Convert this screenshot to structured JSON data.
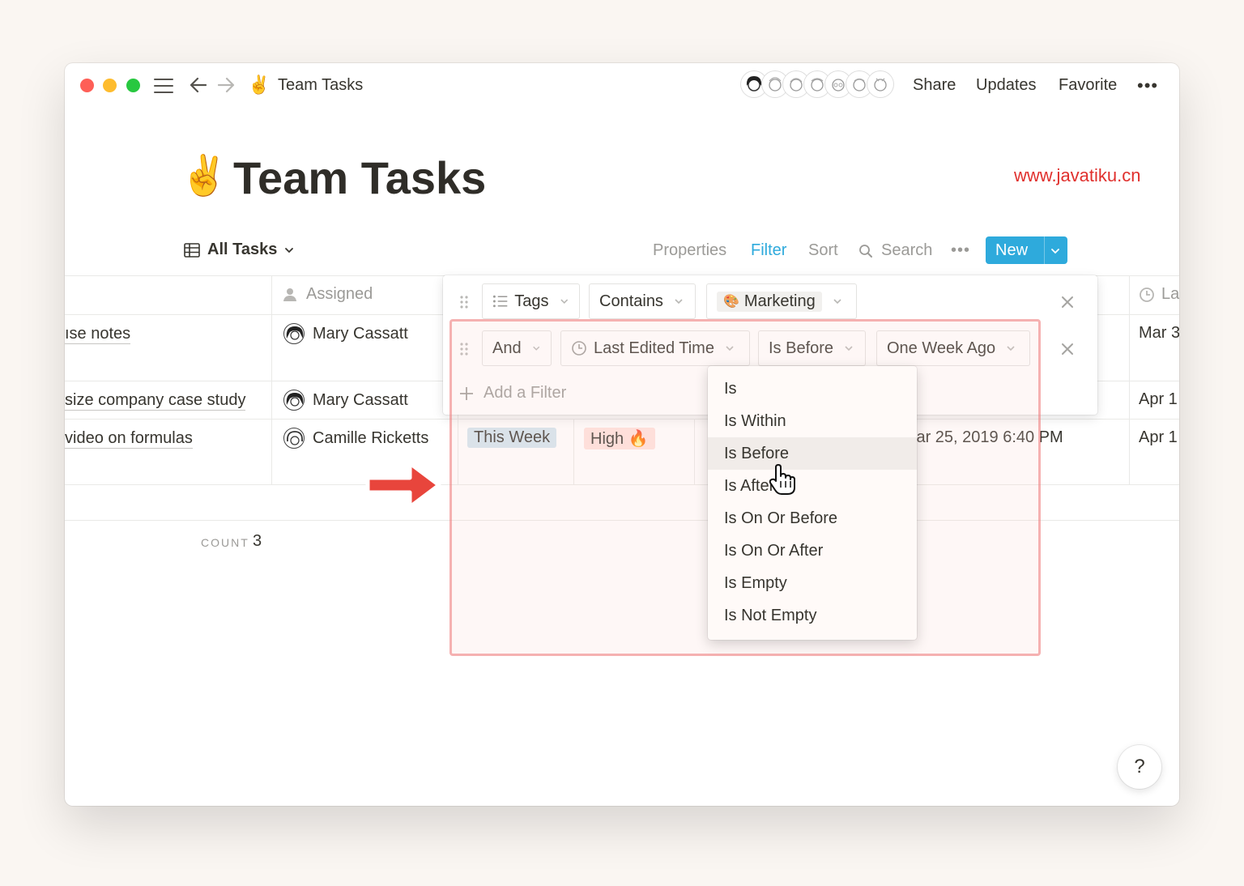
{
  "titlebar": {
    "page_emoji": "✌️",
    "page_title": "Team Tasks",
    "share": "Share",
    "updates": "Updates",
    "favorite": "Favorite",
    "more": "•••"
  },
  "page": {
    "emoji": "✌️",
    "title": "Team Tasks",
    "watermark": "www.javatiku.cn"
  },
  "view_bar": {
    "view_name": "All Tasks",
    "properties": "Properties",
    "filter": "Filter",
    "sort": "Sort",
    "search": "Search",
    "more": "•••",
    "new": "New"
  },
  "table": {
    "headers": {
      "assigned": "Assigned",
      "last": "La"
    },
    "rows": [
      {
        "task": "ıse notes",
        "assignee": "Mary Cassatt",
        "last": "Mar 3"
      },
      {
        "task": "size company case study",
        "assignee": "Mary Cassatt",
        "last": "Apr 1"
      },
      {
        "task": "video on formulas",
        "assignee": "Camille Ricketts",
        "when": "This Week",
        "priority": "High 🔥",
        "created": "lar 25, 2019 6:40 PM",
        "last": "Apr 1"
      }
    ],
    "count_label": "COUNT",
    "count_value": "3"
  },
  "filters": {
    "row1": {
      "property": "Tags",
      "operator": "Contains",
      "value": "Marketing",
      "value_emoji": "🎨"
    },
    "row2": {
      "conjunction": "And",
      "property": "Last Edited Time",
      "operator": "Is Before",
      "value": "One Week Ago"
    },
    "add_filter": "Add a Filter"
  },
  "operator_menu": {
    "options": [
      "Is",
      "Is Within",
      "Is Before",
      "Is After",
      "Is On Or Before",
      "Is On Or After",
      "Is Empty",
      "Is Not Empty"
    ],
    "hovered": "Is Before"
  },
  "help": "?",
  "colors": {
    "accent": "#2eaadc",
    "tag_this_week": "#d3e5ef",
    "tag_high": "#ffe2dd",
    "highlight_border": "#ef7878",
    "arrow": "#e8453c",
    "watermark": "#e0302d"
  }
}
